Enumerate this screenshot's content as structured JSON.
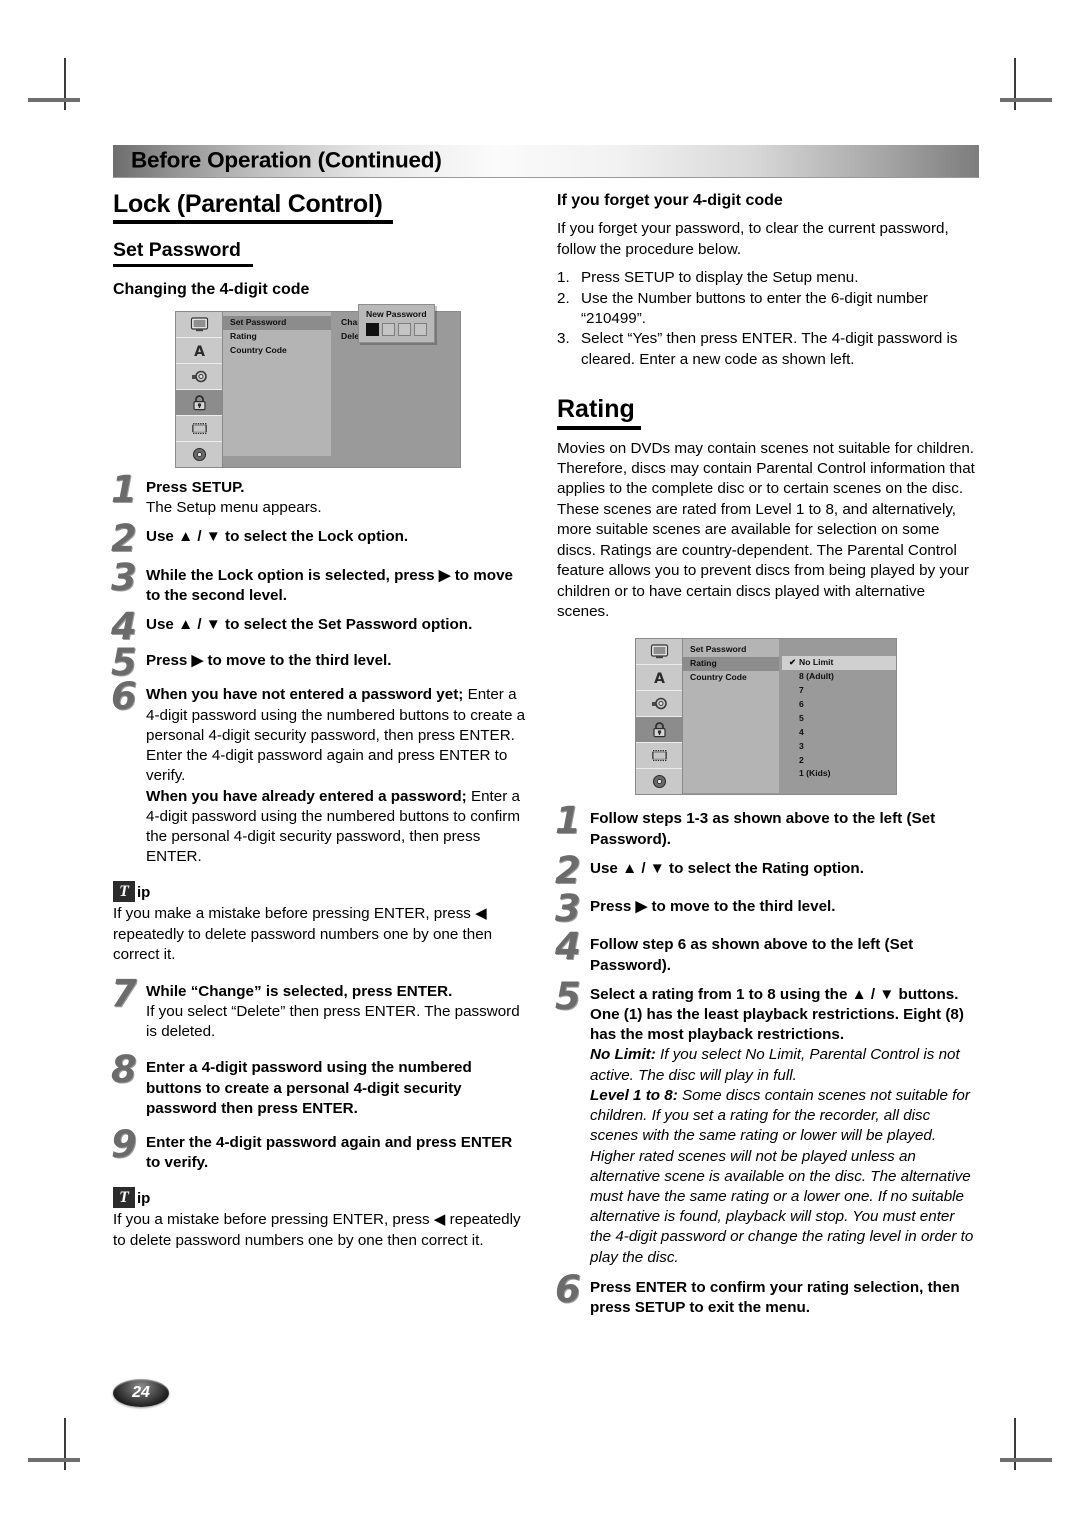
{
  "header": {
    "banner_title": "Before Operation (Continued)"
  },
  "left_column": {
    "main_heading": "Lock (Parental Control)",
    "sub_heading": "Set Password",
    "sub_heading2": "Changing the 4-digit code",
    "osd_menu": {
      "sidebar_icons": [
        "display-icon",
        "language-icon",
        "audio-icon",
        "lock-icon",
        "film-icon",
        "disc-icon"
      ],
      "selected_sidebar_icon": "lock-icon",
      "level2_items": [
        "Set Password",
        "Rating",
        "Country Code"
      ],
      "level2_selected": "Set Password",
      "level3_items": [
        "Change",
        "Delete"
      ],
      "popup": {
        "title": "New Password",
        "boxes": [
          true,
          false,
          false,
          false
        ]
      }
    },
    "steps": [
      {
        "num": "1",
        "bold": "Press SETUP.",
        "rest": "The Setup menu appears."
      },
      {
        "num": "2",
        "bold": "Use ▲ / ▼ to select the Lock option.",
        "rest": ""
      },
      {
        "num": "3",
        "bold": "While the Lock option is selected, press ▶ to move to the second level.",
        "rest": ""
      },
      {
        "num": "4",
        "bold": "Use ▲ / ▼ to select the Set Password option.",
        "rest": ""
      },
      {
        "num": "5",
        "bold": "Press ▶ to move to the third level.",
        "rest": ""
      },
      {
        "num": "6",
        "bold": "When you have not entered a password yet;",
        "rest": "Enter a 4-digit password using the numbered buttons to create a personal 4-digit security password, then press ENTER. Enter the 4-digit password again and press ENTER to verify.",
        "bold2": "When you have already entered a password;",
        "rest2": "Enter a 4-digit password using the numbered buttons to confirm the personal 4-digit security password, then press ENTER."
      }
    ],
    "tip1": {
      "badge": "T",
      "label": "ip",
      "text": "If you make a mistake before pressing ENTER, press ◀ repeatedly to delete password numbers one by one then correct it."
    },
    "steps_cont": [
      {
        "num": "7",
        "bold": "While “Change” is selected, press ENTER.",
        "rest": "If you select “Delete” then press ENTER. The password is deleted."
      },
      {
        "num": "8",
        "bold": "Enter a 4-digit password using the numbered buttons to create a personal 4-digit security password then press ENTER.",
        "rest": ""
      },
      {
        "num": "9",
        "bold": "Enter the 4-digit password again and press ENTER to verify.",
        "rest": ""
      }
    ],
    "tip2": {
      "badge": "T",
      "label": "ip",
      "text": "If you a mistake before pressing ENTER, press ◀ repeatedly to delete password numbers one by one then correct it."
    }
  },
  "right_column": {
    "forget_heading": "If you forget your 4-digit code",
    "forget_intro": "If you forget your password, to clear the current password, follow the procedure below.",
    "forget_steps": [
      {
        "marker": "1.",
        "text": "Press SETUP to display the Setup menu."
      },
      {
        "marker": "2.",
        "text": "Use the Number buttons to enter the 6-digit number “210499”."
      },
      {
        "marker": "3.",
        "text": "Select “Yes” then press ENTER. The 4-digit password is cleared. Enter a new code as shown left."
      }
    ],
    "rating_heading": "Rating",
    "rating_intro": "Movies on DVDs may contain scenes not suitable for children. Therefore, discs may contain Parental Control information that applies to the complete disc or to certain scenes on the disc. These scenes are rated from Level 1 to 8, and alternatively, more suitable scenes are available for selection on some discs. Ratings are country-dependent. The Parental Control feature allows you to prevent discs from being played by your children or to have certain discs played with alternative scenes.",
    "osd_menu": {
      "sidebar_icons": [
        "display-icon",
        "language-icon",
        "audio-icon",
        "lock-icon",
        "film-icon",
        "disc-icon"
      ],
      "selected_sidebar_icon": "lock-icon",
      "level2_items": [
        "Set Password",
        "Rating",
        "Country Code"
      ],
      "level2_selected": "Rating",
      "level3_items": [
        "No Limit",
        "8 (Adult)",
        "7",
        "6",
        "5",
        "4",
        "3",
        "2",
        "1 (Kids)"
      ],
      "level3_selected": "No Limit",
      "check_glyph": "✔"
    },
    "steps": [
      {
        "num": "1",
        "bold": "Follow steps 1-3 as shown above to the left (Set Password).",
        "rest": ""
      },
      {
        "num": "2",
        "bold": "Use ▲ / ▼ to select the Rating option.",
        "rest": ""
      },
      {
        "num": "3",
        "bold": "Press ▶ to move to the third level.",
        "rest": ""
      },
      {
        "num": "4",
        "bold": "Follow step 6 as shown above to the left (Set Password).",
        "rest": ""
      },
      {
        "num": "5",
        "bold": "Select a rating from 1 to 8 using the ▲ / ▼ buttons. One (1) has the least playback restrictions. Eight (8) has the most playback restrictions.",
        "italic_bold_1": "No Limit:",
        "italic_1": " If you select No Limit, Parental Control is not active. The disc will play in full.",
        "italic_bold_2": "Level 1 to 8:",
        "italic_2": " Some discs contain scenes not suitable for children. If you set a rating for the recorder, all disc scenes with the same rating or lower will be played. Higher rated scenes will not be played unless an alternative scene is available on the disc. The alternative must have the same rating or a lower one. If no suitable alternative is found, playback will stop. You must enter the 4-digit password or change the rating level in order to play the disc."
      },
      {
        "num": "6",
        "bold": "Press ENTER to confirm your rating selection, then press SETUP to exit the menu.",
        "rest": ""
      }
    ]
  },
  "footer": {
    "page_number": "24"
  }
}
